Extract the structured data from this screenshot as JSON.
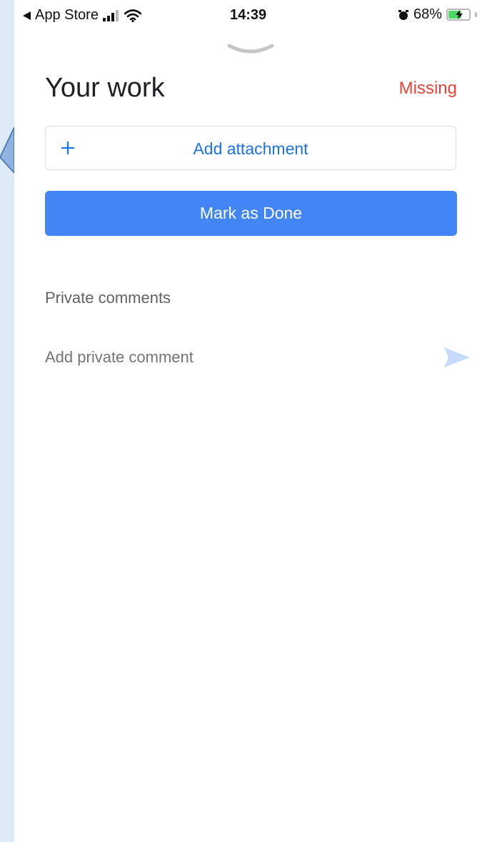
{
  "status_bar": {
    "back_app": "App Store",
    "time": "14:39",
    "battery_percent": "68%",
    "battery_level": 0.68,
    "icons": [
      "back-triangle-icon",
      "signal-icon",
      "wifi-icon",
      "alarm-icon",
      "battery-charging-icon"
    ]
  },
  "sheet": {
    "title": "Your work",
    "status": "Missing",
    "add_attachment_label": "Add attachment",
    "mark_done_label": "Mark as Done"
  },
  "comments": {
    "heading": "Private comments",
    "placeholder": "Add private comment",
    "value": ""
  },
  "colors": {
    "accent": "#4285f4",
    "link": "#1a73e8",
    "missing": "#ea4335",
    "send_disabled": "#c6dafc"
  }
}
